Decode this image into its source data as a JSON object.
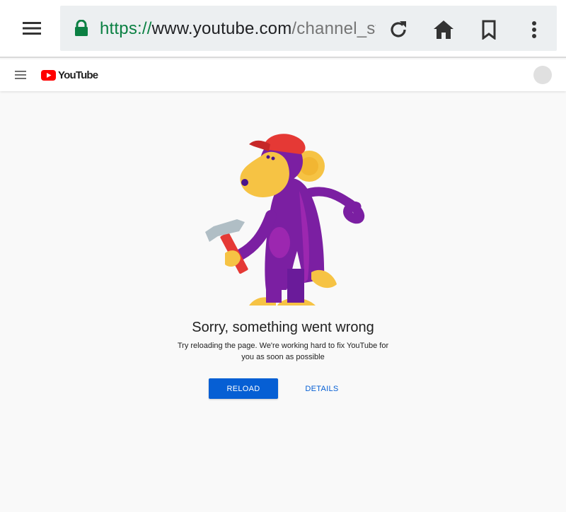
{
  "browser": {
    "url_scheme": "https://",
    "url_host": "www.youtube.com",
    "url_path": "/channel_switch",
    "icons": [
      "menu-icon",
      "lock-icon",
      "reload-icon",
      "home-icon",
      "bookmark-icon",
      "more-vert-icon"
    ]
  },
  "header": {
    "logo_text": "YouTube",
    "icons": [
      "guide-menu-icon",
      "youtube-play-icon",
      "account-avatar"
    ]
  },
  "error": {
    "illustration": "monkey-with-hammer",
    "title": "Sorry, something went wrong",
    "message": "Try reloading the page. We're working hard to fix YouTube for you as soon as possible",
    "reload_label": "RELOAD",
    "details_label": "DETAILS"
  },
  "colors": {
    "url_scheme_green": "#0b8043",
    "youtube_red": "#ff0000",
    "button_blue": "#065fd4",
    "page_background": "#f9f9f9"
  }
}
